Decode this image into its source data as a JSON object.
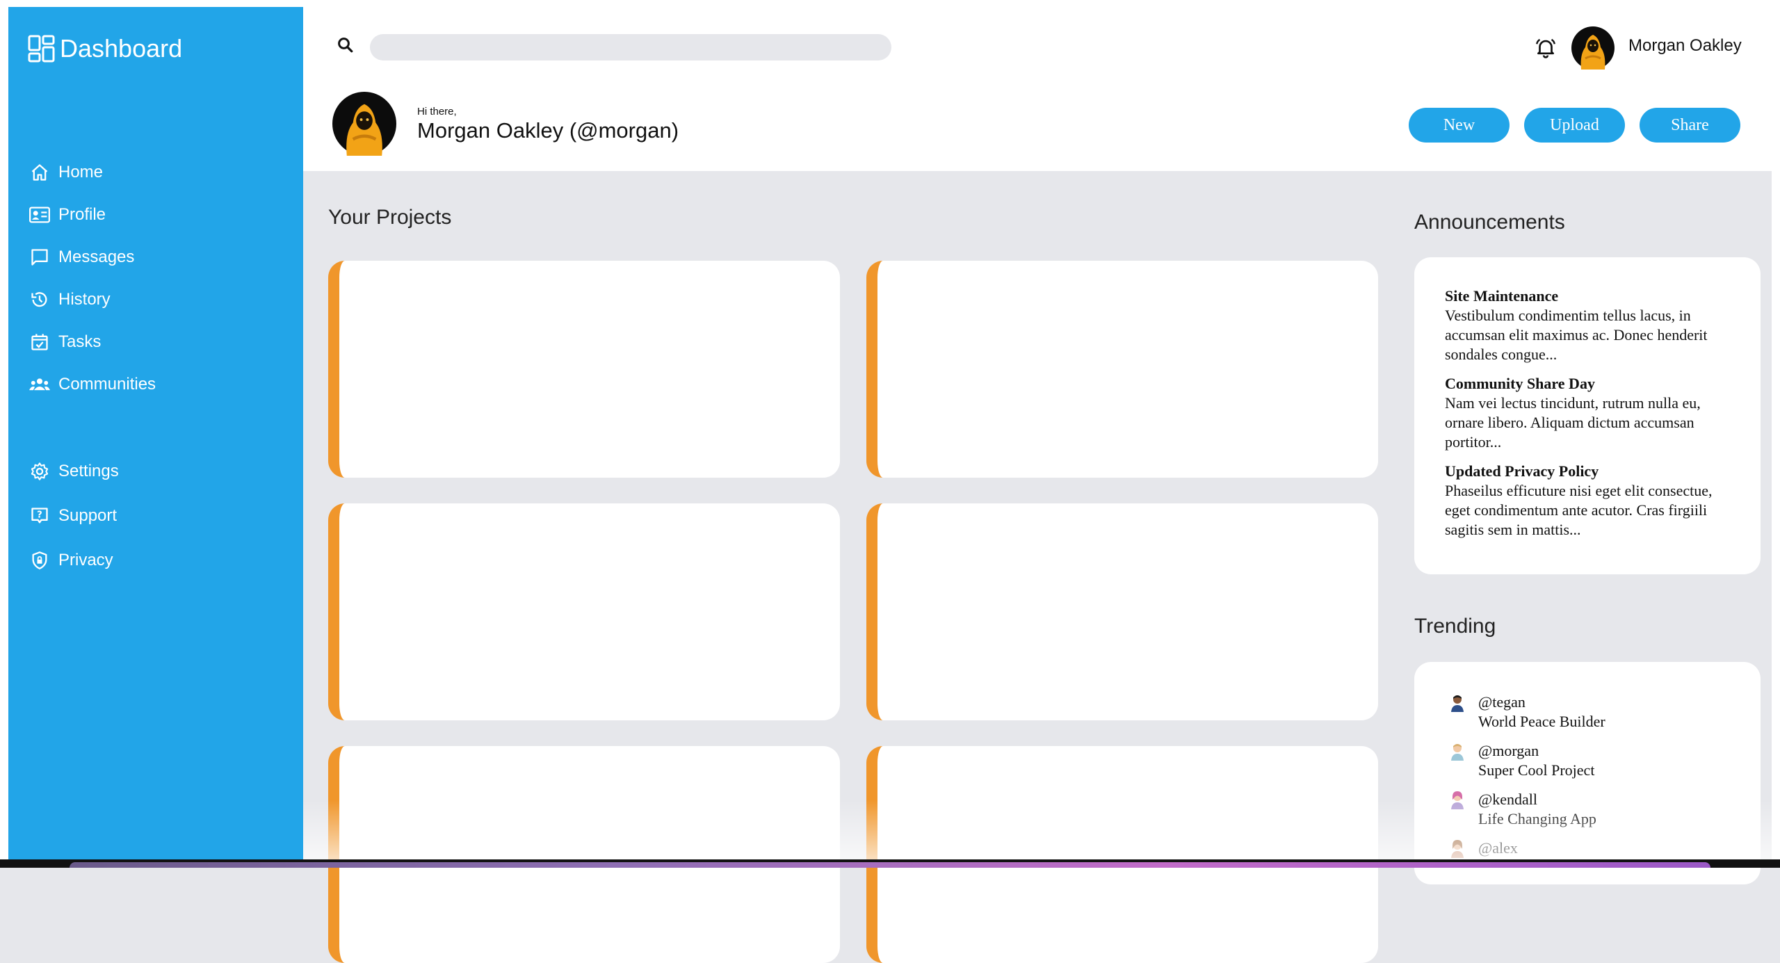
{
  "brand": {
    "label": "Dashboard",
    "icon": "dashboard-icon"
  },
  "sidebar": {
    "items": [
      {
        "label": "Home",
        "icon": "home-icon"
      },
      {
        "label": "Profile",
        "icon": "id-card-icon"
      },
      {
        "label": "Messages",
        "icon": "message-icon"
      },
      {
        "label": "History",
        "icon": "history-icon"
      },
      {
        "label": "Tasks",
        "icon": "calendar-check-icon"
      },
      {
        "label": "Communities",
        "icon": "people-icon"
      }
    ],
    "secondary": [
      {
        "label": "Settings",
        "icon": "gear-icon"
      },
      {
        "label": "Support",
        "icon": "help-icon"
      },
      {
        "label": "Privacy",
        "icon": "shield-lock-icon"
      }
    ]
  },
  "topbar": {
    "search_placeholder": "",
    "user_name": "Morgan Oakley"
  },
  "greeting": {
    "small": "Hi there,",
    "name": "Morgan Oakley (@morgan)"
  },
  "actions": {
    "new_label": "New",
    "upload_label": "Upload",
    "share_label": "Share"
  },
  "projects": {
    "title": "Your Projects",
    "count_visible": 6
  },
  "announcements": {
    "title": "Announcements",
    "items": [
      {
        "title": "Site Maintenance",
        "body": "Vestibulum condimentim tellus lacus, in accumsan elit maximus ac. Donec henderit sondales congue..."
      },
      {
        "title": "Community Share Day",
        "body": "Nam vei lectus tincidunt, rutrum nulla eu, ornare libero. Aliquam dictum accumsan portitor..."
      },
      {
        "title": "Updated Privacy Policy",
        "body": "Phaseilus efficuture nisi eget elit consectue, eget condimentum ante acutor. Cras firgiili sagitis sem in mattis..."
      }
    ]
  },
  "trending": {
    "title": "Trending",
    "items": [
      {
        "handle": "@tegan",
        "project": "World Peace Builder"
      },
      {
        "handle": "@morgan",
        "project": "Super Cool Project"
      },
      {
        "handle": "@kendall",
        "project": "Life Changing App"
      },
      {
        "handle": "@alex",
        "project": ""
      }
    ]
  },
  "colors": {
    "sidebar": "#22a5e8",
    "accent": "#f0962b",
    "background": "#e6e7eb"
  }
}
